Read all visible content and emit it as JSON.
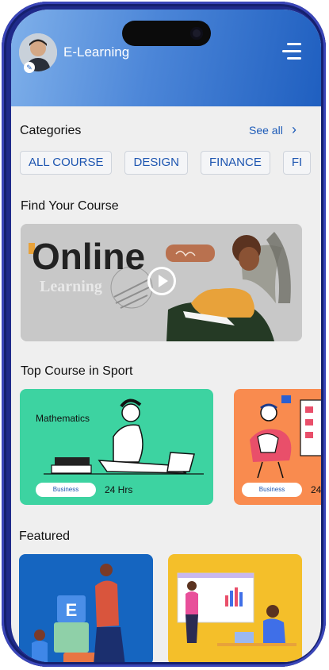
{
  "header": {
    "app_title": "E-Learning"
  },
  "categories": {
    "title": "Categories",
    "see_all": "See all",
    "chips": [
      "ALL COURSE",
      "DESIGN",
      "FINANCE",
      "FI"
    ]
  },
  "find_course": {
    "title": "Find Your Course",
    "video": {
      "word1": "Online",
      "word2": "Learning"
    }
  },
  "top_course": {
    "title": "Top Course in Sport",
    "cards": [
      {
        "name": "Mathematics",
        "tag": "Business",
        "duration": "24 Hrs"
      },
      {
        "name": "",
        "tag": "Business",
        "duration": "24"
      }
    ]
  },
  "featured": {
    "title": "Featured",
    "tile_letter": "E"
  },
  "colors": {
    "accent": "#1d55b0",
    "card_green": "#3dd3a1",
    "card_orange": "#f98b4f",
    "featured_blue": "#1565c0",
    "featured_yellow": "#f4bf2a"
  }
}
